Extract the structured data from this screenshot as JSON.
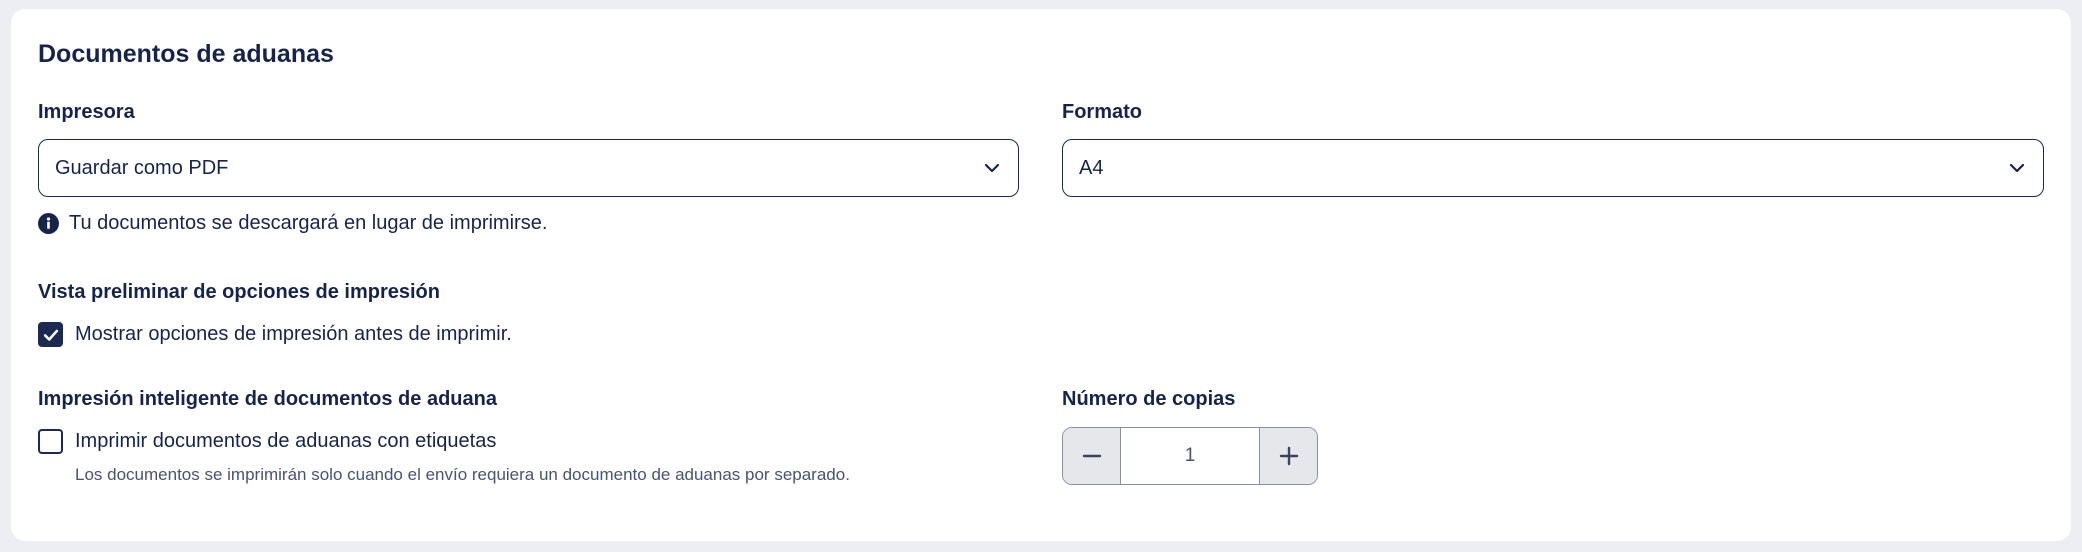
{
  "section": {
    "title": "Documentos de aduanas"
  },
  "printer": {
    "label": "Impresora",
    "value": "Guardar como PDF",
    "info": "Tu documentos se descargará en lugar de imprimirse."
  },
  "format": {
    "label": "Formato",
    "value": "A4"
  },
  "preview": {
    "label": "Vista preliminar de opciones de impresión",
    "checkbox_label": "Mostrar opciones de impresión antes de imprimir.",
    "checked": true
  },
  "smart_print": {
    "label": "Impresión inteligente de documentos de aduana",
    "checkbox_label": "Imprimir documentos de aduanas con etiquetas",
    "checked": false,
    "help": "Los documentos se imprimirán solo cuando el envío requiera un documento de aduanas por separado."
  },
  "copies": {
    "label": "Número de copias",
    "value": "1"
  },
  "colors": {
    "text": "#17244a",
    "accent": "#1c2a52",
    "stepper_bg": "#e6e7eb"
  },
  "icons": {
    "info": "info-circle-icon",
    "chevron": "chevron-down-icon",
    "minus": "minus-icon",
    "plus": "plus-icon",
    "check": "checkmark-icon"
  }
}
